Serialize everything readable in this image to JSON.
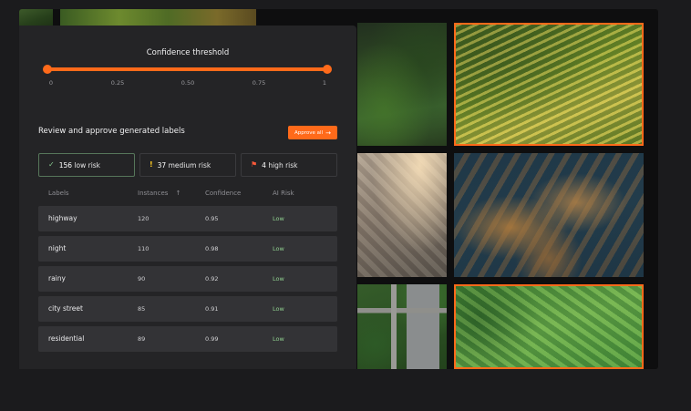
{
  "threshold": {
    "title": "Confidence threshold",
    "ticks": [
      "0",
      "0.25",
      "0.50",
      "0.75",
      "1"
    ],
    "range_min": 0,
    "range_max": 1
  },
  "review": {
    "title": "Review and approve generated labels",
    "approve_label": "Approve all",
    "approve_icon": "arrow-right-icon"
  },
  "risk_filters": [
    {
      "count": "156",
      "label": "low risk",
      "icon": "check-icon",
      "color": "#86c98e"
    },
    {
      "count": "37",
      "label": "medium risk",
      "icon": "exclamation-icon",
      "color": "#ffcc22"
    },
    {
      "count": "4",
      "label": "high risk",
      "icon": "flag-icon",
      "color": "#ff5a3a"
    }
  ],
  "table": {
    "headers": {
      "labels": "Labels",
      "instances": "Instances",
      "confidence": "Confidence",
      "risk": "AI Risk"
    },
    "rows": [
      {
        "label": "highway",
        "instances": "120",
        "confidence": "0.95",
        "risk": "Low"
      },
      {
        "label": "night",
        "instances": "110",
        "confidence": "0.98",
        "risk": "Low"
      },
      {
        "label": "rainy",
        "instances": "90",
        "confidence": "0.92",
        "risk": "Low"
      },
      {
        "label": "city street",
        "instances": "85",
        "confidence": "0.91",
        "risk": "Low"
      },
      {
        "label": "residential",
        "instances": "89",
        "confidence": "0.99",
        "risk": "Low"
      }
    ]
  },
  "colors": {
    "accent": "#ff6a1a",
    "low_risk": "#8fcf8f",
    "panel": "#242426"
  }
}
